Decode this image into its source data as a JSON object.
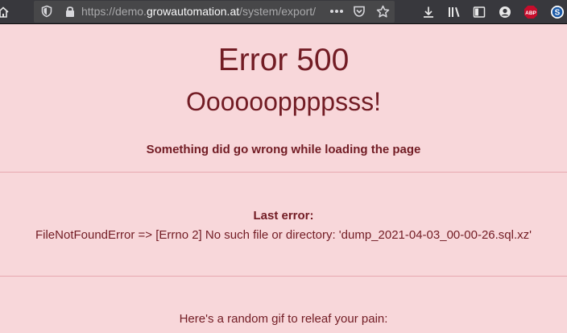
{
  "browser": {
    "url_prefix": "https://demo.",
    "url_domain": "growautomation.at",
    "url_path": "/system/export/",
    "icons": {
      "home": "home-icon",
      "shield": "tracking-shield-icon",
      "lock": "lock-icon",
      "page_actions": "page-actions-icon",
      "pocket": "pocket-icon",
      "bookmark": "bookmark-star-icon",
      "download": "download-icon",
      "library": "library-icon",
      "sidebar": "sidebar-icon",
      "account": "account-icon",
      "abp": "adblock-plus-icon",
      "s_ext": "s-extension-icon"
    },
    "abp_label": "ABP",
    "s_label": "S"
  },
  "page": {
    "title": "Error 500",
    "subtitle": "Ooooooppppsss!",
    "message": "Something did go wrong while loading the page",
    "last_error_label": "Last error:",
    "last_error_text": "FileNotFoundError => [Errno 2] No such file or directory: 'dump_2021-04-03_00-00-26.sql.xz'",
    "gif_text": "Here's a random gif to releaf your pain:"
  },
  "colors": {
    "page_background": "#f8d7da",
    "text": "#721c24",
    "divider": "#e7a8b0",
    "toolbar": "#38383d",
    "urlbar": "#474749"
  }
}
